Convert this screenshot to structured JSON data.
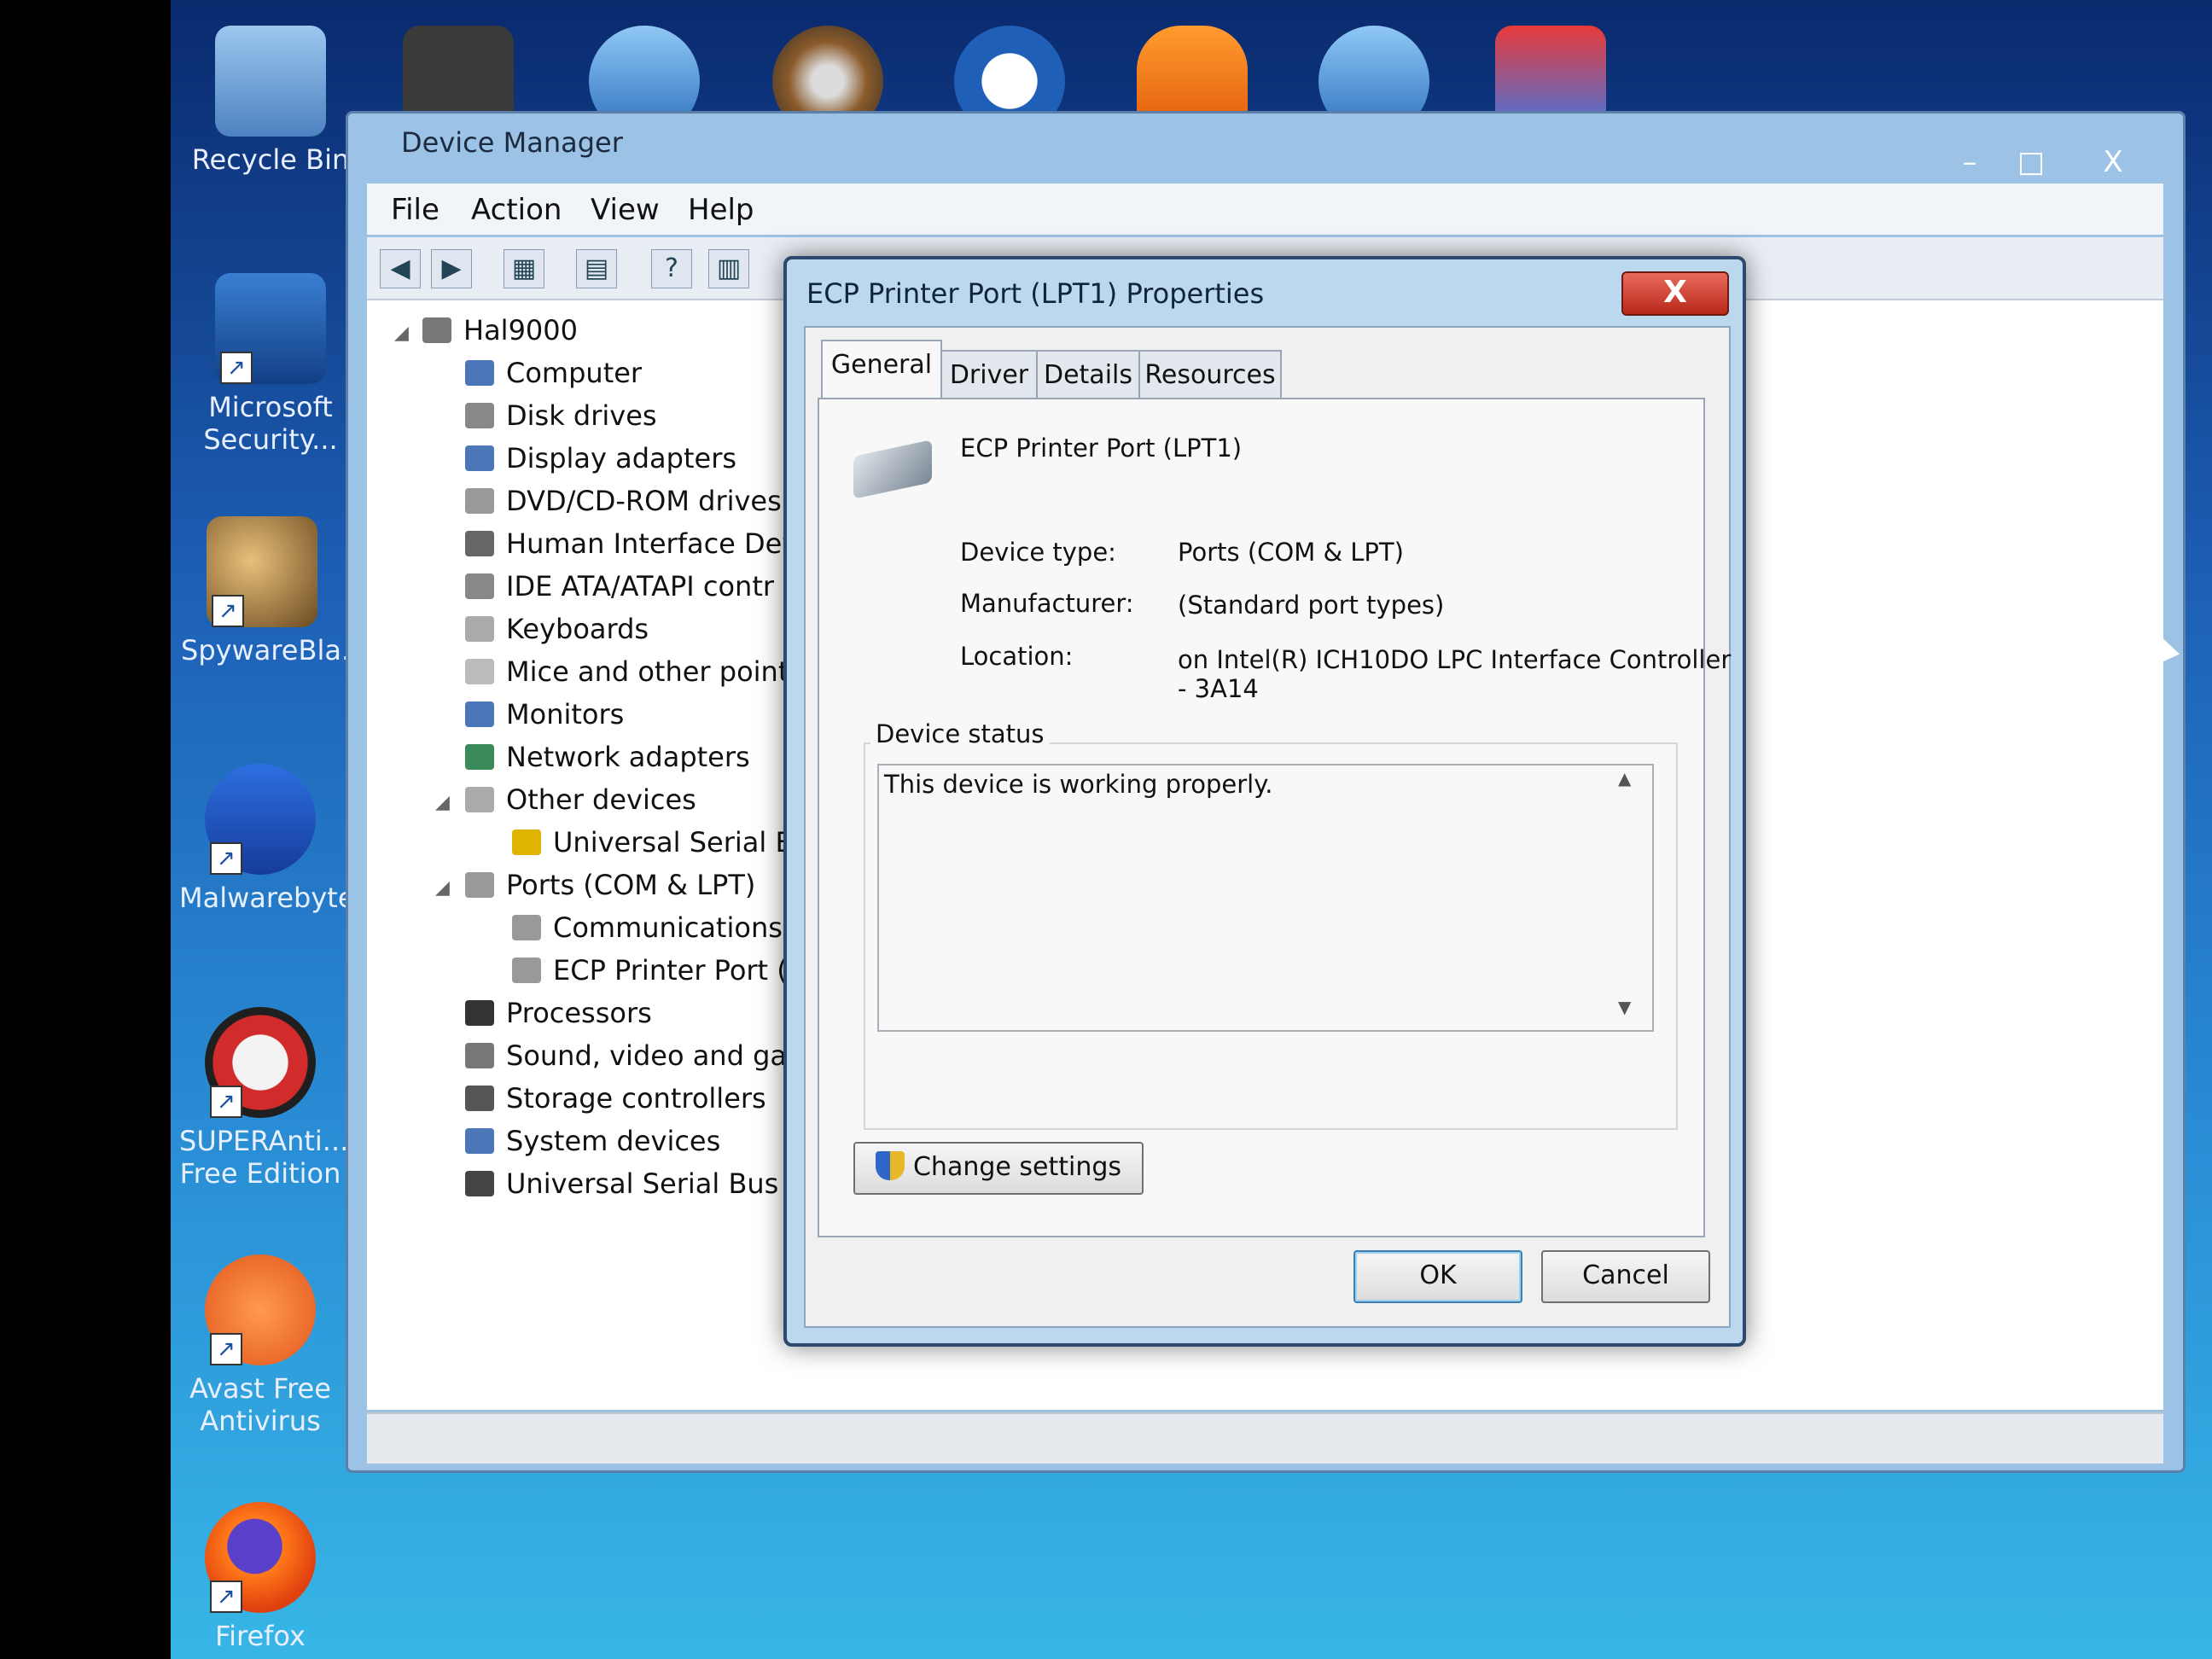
{
  "desktop": {
    "icons": [
      {
        "label": "Recycle Bin",
        "icon": "recycle-bin-icon"
      },
      {
        "label": "Microsoft Security...",
        "icon": "microsoft-security-icon"
      },
      {
        "label": "SpywareBla...",
        "icon": "spywareblaster-icon"
      },
      {
        "label": "Malwarebyte",
        "icon": "malwarebytes-icon"
      },
      {
        "label": "SUPERAnti... Free Edition",
        "icon": "superantispyware-icon"
      },
      {
        "label": "Avast Free Antivirus",
        "icon": "avast-icon"
      },
      {
        "label": "Firefox",
        "icon": "firefox-icon"
      }
    ]
  },
  "device_manager": {
    "title": "Device Manager",
    "window_buttons": {
      "minimize": "–",
      "maximize": "□",
      "close": "X"
    },
    "menu": [
      "File",
      "Action",
      "View",
      "Help"
    ],
    "tree": {
      "root": "Hal9000",
      "items": [
        "Computer",
        "Disk drives",
        "Display adapters",
        "DVD/CD-ROM drives",
        "Human Interface Devi",
        "IDE ATA/ATAPI contr",
        "Keyboards",
        "Mice and other pointi",
        "Monitors",
        "Network adapters",
        "Other devices",
        "Universal Serial Bu",
        "Ports (COM & LPT)",
        "Communications",
        "ECP Printer Port (L",
        "Processors",
        "Sound, video and gar",
        "Storage controllers",
        "System devices",
        "Universal Serial Bus c"
      ]
    }
  },
  "dialog": {
    "title": "ECP Printer Port (LPT1) Properties",
    "close": "X",
    "tabs": [
      "General",
      "Driver",
      "Details",
      "Resources"
    ],
    "device_name": "ECP Printer Port (LPT1)",
    "device_type_label": "Device type:",
    "device_type_value": "Ports (COM & LPT)",
    "manufacturer_label": "Manufacturer:",
    "manufacturer_value": "(Standard port types)",
    "location_label": "Location:",
    "location_value_line1": "on Intel(R) ICH10DO LPC Interface Controller",
    "location_value_line2": "- 3A14",
    "status_group_label": "Device status",
    "status_text": "This device is working properly.",
    "change_settings": "Change settings",
    "ok": "OK",
    "cancel": "Cancel"
  }
}
